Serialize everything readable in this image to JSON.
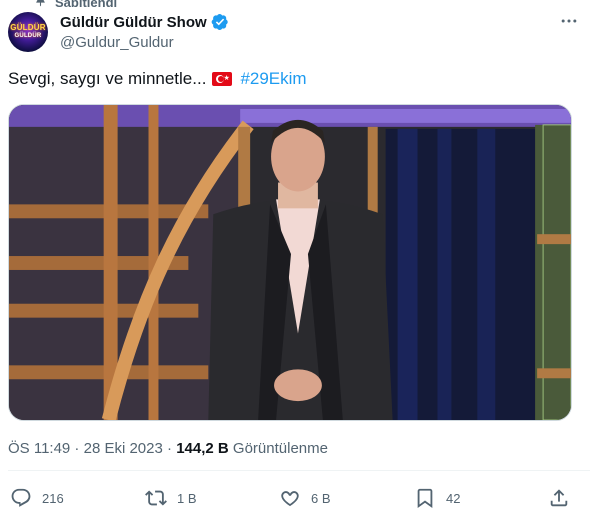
{
  "pinned": {
    "label": "Sabitlendi"
  },
  "author": {
    "display_name": "Güldür Güldür Show",
    "handle": "@Guldur_Guldur",
    "verified": true,
    "avatar_logo_line1": "GÜLDÜR",
    "avatar_logo_line2": "GÜLDÜR"
  },
  "tweet": {
    "text": "Sevgi, saygı ve minnetle...",
    "hashtag": "#29Ekim"
  },
  "meta": {
    "time": "ÖS 11:49",
    "separator": " · ",
    "date": "28 Eki 2023",
    "views_count": "144,2 B",
    "views_label": "Görüntülenme"
  },
  "actions": {
    "replies": "216",
    "retweets": "1 B",
    "likes": "6 B",
    "bookmarks": "42"
  },
  "colors": {
    "accent": "#1d9bf0",
    "secondary_text": "#536471",
    "primary_text": "#0f1419",
    "flag_red": "#e30a17"
  }
}
